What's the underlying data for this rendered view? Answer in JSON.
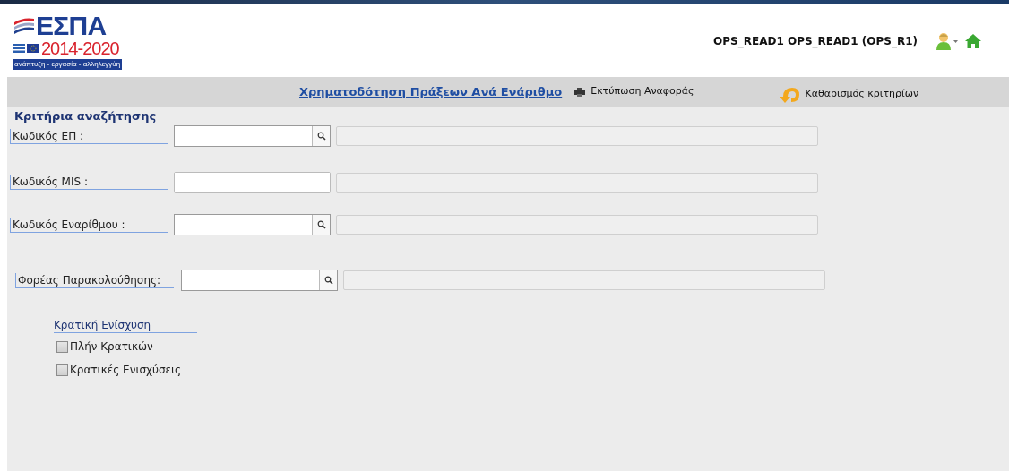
{
  "logo": {
    "title": "ΕΣΠΑ",
    "years": "2014-2020",
    "slogan": "ανάπτυξη - εργασία - αλληλεγγύη"
  },
  "user": {
    "name": "OPS_READ1 OPS_READ1 (OPS_R1)"
  },
  "toolbar": {
    "title": "Χρηματοδότηση Πράξεων Ανά Ενάριθμο",
    "print": "Εκτύπωση Αναφοράς",
    "clear": "Καθαρισμός κριτηρίων"
  },
  "criteria": {
    "heading": "Κριτήρια αναζήτησης",
    "fields": [
      {
        "label": "Κωδικός ΕΠ :",
        "kind": "lookup"
      },
      {
        "label": "Κωδικός MIS :",
        "kind": "text"
      },
      {
        "label": "Κωδικός Εναρίθμου :",
        "kind": "lookup"
      },
      {
        "label": "Φορέας Παρακολούθησης:",
        "kind": "lookup"
      }
    ]
  },
  "state_aid": {
    "label": "Κρατική Ενίσχυση",
    "options": [
      {
        "label": "Πλήν Κρατικών",
        "checked": false
      },
      {
        "label": "Κρατικές Ενισχύσεις",
        "checked": false
      }
    ]
  }
}
